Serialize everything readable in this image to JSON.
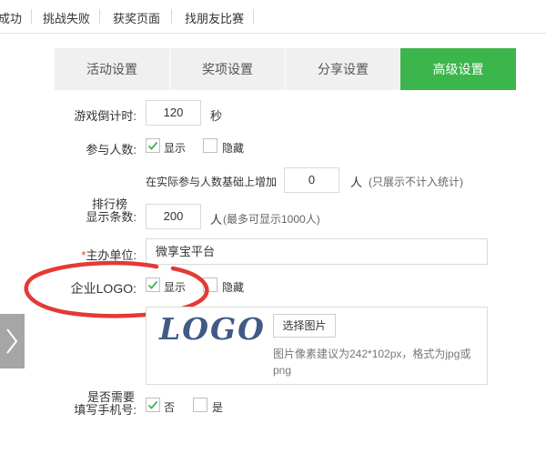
{
  "top_tabs": [
    "成功",
    "挑战失败",
    "获奖页面",
    "找朋友比赛"
  ],
  "setting_tabs": [
    {
      "label": "活动设置",
      "active": false
    },
    {
      "label": "奖项设置",
      "active": false
    },
    {
      "label": "分享设置",
      "active": false
    },
    {
      "label": "高级设置",
      "active": true
    }
  ],
  "form": {
    "countdown": {
      "label": "游戏倒计时:",
      "value": "120",
      "unit": "秒"
    },
    "participants": {
      "label": "参与人数:",
      "show_label": "显示",
      "show_checked": true,
      "hide_label": "隐藏",
      "hide_checked": false,
      "add_prefix": "在实际参与人数基础上增加",
      "add_value": "0",
      "add_unit": "人",
      "add_note": "(只展示不计入统计)"
    },
    "ranking": {
      "label_line1": "排行榜",
      "label_line2": "显示条数:",
      "value": "200",
      "unit": "人",
      "note": "(最多可显示1000人)"
    },
    "organizer": {
      "required_mark": "*",
      "label": "主办单位:",
      "value": "微享宝平台"
    },
    "logo": {
      "label": "企业LOGO:",
      "show_label": "显示",
      "show_checked": true,
      "hide_label": "隐藏",
      "hide_checked": false,
      "logo_text": "LOGO",
      "pick_button": "选择图片",
      "hint": "图片像素建议为242*102px，格式为jpg或png"
    },
    "phone": {
      "label_line1": "是否需要",
      "label_line2": "填写手机号:",
      "no_label": "否",
      "no_checked": true,
      "yes_label": "是",
      "yes_checked": false
    }
  },
  "colors": {
    "accent": "#3cb54d",
    "annotation": "#e53935",
    "logo": "#3f5a85"
  },
  "icons": {
    "side_nav": "chevron-right-icon",
    "checkbox": "check-icon"
  }
}
